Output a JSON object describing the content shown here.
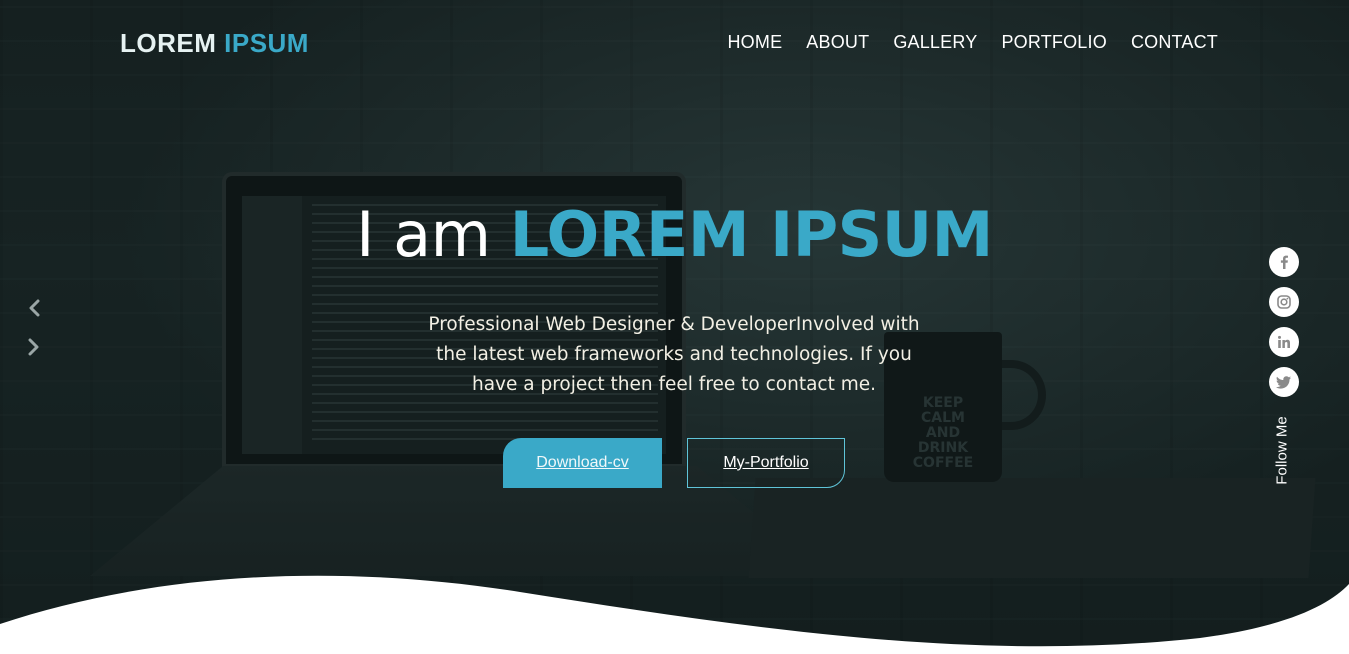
{
  "header": {
    "logo_part1": "LOREM",
    "logo_part2": "IPSUM",
    "nav": [
      {
        "label": "HOME"
      },
      {
        "label": "ABOUT"
      },
      {
        "label": "GALLERY"
      },
      {
        "label": "PORTFOLIO"
      },
      {
        "label": "CONTACT"
      }
    ]
  },
  "hero": {
    "intro": "I am",
    "name": "LOREM IPSUM",
    "tagline": "Professional Web Designer & DeveloperInvolved with the latest web frameworks and technologies. If you have a project then feel free to contact me.",
    "download_label": "Download-cv",
    "portfolio_label": "My-Portfolio",
    "mug_text": "KEEP CALM AND DRINK COFFEE"
  },
  "slider": {
    "prev_icon": "chevron-left-icon",
    "next_icon": "chevron-right-icon"
  },
  "social": {
    "icons": [
      "facebook-icon",
      "instagram-icon",
      "linkedin-icon",
      "twitter-icon"
    ],
    "follow_label": "Follow Me"
  },
  "colors": {
    "accent": "#3aa9c8",
    "text": "#ffffff",
    "background": "#1a2626"
  }
}
